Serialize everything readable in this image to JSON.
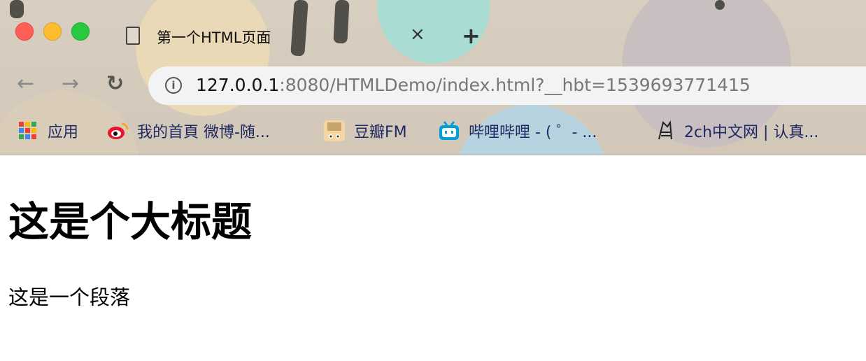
{
  "window": {
    "traffic_lights": [
      "#fe5f57",
      "#febc2e",
      "#28c840"
    ]
  },
  "tab": {
    "title": "第一个HTML页面",
    "close_label": "×",
    "new_tab_label": "+"
  },
  "nav": {
    "back_label": "←",
    "forward_label": "→",
    "reload_label": "↻"
  },
  "address_bar": {
    "info_label": "i",
    "host": "127.0.0.1",
    "rest": ":8080/HTMLDemo/index.html?__hbt=1539693771415"
  },
  "bookmarks": [
    {
      "label": "应用",
      "icon": "apps-grid-icon"
    },
    {
      "label": "我的首頁 微博-随...",
      "icon": "weibo-icon"
    },
    {
      "label": "豆瓣FM",
      "icon": "douban-fm-icon"
    },
    {
      "label": "哔哩哔哩 - ( ゜- ...",
      "icon": "bilibili-icon"
    },
    {
      "label": "2ch中文网 | 认真...",
      "icon": "2ch-icon"
    }
  ],
  "page": {
    "heading": "这是个大标题",
    "paragraph": "这是一个段落"
  }
}
